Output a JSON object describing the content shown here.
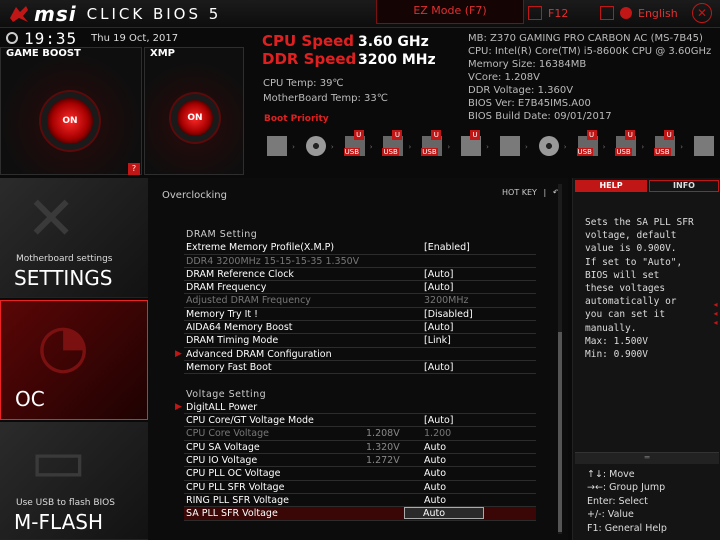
{
  "header": {
    "brand": "msi",
    "product": "CLICK BIOS 5",
    "ez_mode": "EZ Mode (F7)",
    "screenshot": "F12",
    "language": "English",
    "accent": "#c01616"
  },
  "status": {
    "time": "19:35",
    "date": "Thu  19 Oct, 2017"
  },
  "game_boost": {
    "title": "GAME BOOST",
    "state": "ON"
  },
  "xmp": {
    "title": "XMP",
    "state": "ON"
  },
  "speeds": {
    "cpu_label": "CPU Speed",
    "cpu_value": "3.60 GHz",
    "ddr_label": "DDR Speed",
    "ddr_value": "3200 MHz",
    "cpu_temp": "CPU Temp: 39℃",
    "mb_temp": "MotherBoard Temp: 33℃"
  },
  "sysinfo": {
    "mb": "MB: Z370 GAMING PRO CARBON AC (MS-7B45)",
    "cpu": "CPU: Intel(R) Core(TM) i5-8600K CPU @ 3.60GHz",
    "mem": "Memory Size: 16384MB",
    "vcore": "VCore: 1.208V",
    "ddr_voltage": "DDR Voltage: 1.360V",
    "bios_ver": "BIOS Ver: E7B45IMS.A00",
    "bios_date": "BIOS Build Date: 09/01/2017"
  },
  "boot": {
    "label": "Boot Priority",
    "devices": [
      {
        "kind": "hdd",
        "icon": "hard-drive-icon",
        "badge": ""
      },
      {
        "kind": "disc",
        "icon": "optical-disc-icon",
        "badge": ""
      },
      {
        "kind": "usb",
        "icon": "usb-drive-icon",
        "text": "USB",
        "badge": "U"
      },
      {
        "kind": "usb",
        "icon": "usb-drive-icon",
        "text": "USB",
        "badge": "U"
      },
      {
        "kind": "usb",
        "icon": "usb-key-icon",
        "text": "USB",
        "badge": "U"
      },
      {
        "kind": "hdd",
        "icon": "floppy-icon",
        "badge": "U"
      },
      {
        "kind": "hdd",
        "icon": "network-card-icon",
        "badge": ""
      },
      {
        "kind": "disc",
        "icon": "optical-disc-icon",
        "badge": ""
      },
      {
        "kind": "usb",
        "icon": "usb-drive-icon",
        "text": "USB",
        "badge": "U"
      },
      {
        "kind": "usb",
        "icon": "usb-drive-icon",
        "text": "USB",
        "badge": "U"
      },
      {
        "kind": "usb",
        "icon": "usb-key-icon",
        "text": "USB",
        "badge": "U"
      },
      {
        "kind": "hdd",
        "icon": "network-card-icon",
        "badge": ""
      }
    ]
  },
  "nav": {
    "settings_sub": "Motherboard settings",
    "settings": "SETTINGS",
    "oc": "OC",
    "mflash_sub": "Use USB to flash BIOS",
    "mflash": "M-FLASH"
  },
  "main": {
    "title": "Overclocking",
    "hotkey": "HOT KEY",
    "hotkey_sep": "|"
  },
  "rows": [
    {
      "type": "section",
      "label": "DRAM Setting"
    },
    {
      "type": "item",
      "label": "Extreme Memory Profile(X.M.P)",
      "cur": "",
      "value": "[Enabled]"
    },
    {
      "type": "dim",
      "label": "DDR4 3200MHz 15-15-15-35 1.350V",
      "cur": "",
      "value": ""
    },
    {
      "type": "item",
      "label": "DRAM Reference Clock",
      "cur": "",
      "value": "[Auto]"
    },
    {
      "type": "item",
      "label": "DRAM Frequency",
      "cur": "",
      "value": "[Auto]"
    },
    {
      "type": "dim",
      "label": "Adjusted DRAM Frequency",
      "cur": "",
      "value": "3200MHz"
    },
    {
      "type": "item",
      "label": "Memory Try It !",
      "cur": "",
      "value": "[Disabled]"
    },
    {
      "type": "item",
      "label": "AIDA64 Memory Boost",
      "cur": "",
      "value": "[Auto]"
    },
    {
      "type": "item",
      "label": "DRAM Timing Mode",
      "cur": "",
      "value": "[Link]"
    },
    {
      "type": "sub",
      "label": "Advanced DRAM Configuration",
      "cur": "",
      "value": ""
    },
    {
      "type": "item",
      "label": "Memory Fast Boot",
      "cur": "",
      "value": "[Auto]"
    },
    {
      "type": "gap",
      "label": "",
      "cur": "",
      "value": ""
    },
    {
      "type": "section",
      "label": "Voltage Setting"
    },
    {
      "type": "sub",
      "label": "DigitALL Power",
      "cur": "",
      "value": ""
    },
    {
      "type": "item",
      "label": "CPU Core/GT Voltage Mode",
      "cur": "",
      "value": "[Auto]"
    },
    {
      "type": "dim",
      "label": "CPU Core Voltage",
      "cur": "1.208V",
      "value": "1.200"
    },
    {
      "type": "item",
      "label": "CPU SA Voltage",
      "cur": "1.320V",
      "value": "Auto"
    },
    {
      "type": "item",
      "label": "CPU IO Voltage",
      "cur": "1.272V",
      "value": "Auto"
    },
    {
      "type": "item",
      "label": "CPU PLL OC Voltage",
      "cur": "",
      "value": "Auto"
    },
    {
      "type": "item",
      "label": "CPU PLL SFR Voltage",
      "cur": "",
      "value": "Auto"
    },
    {
      "type": "item",
      "label": "RING PLL SFR Voltage",
      "cur": "",
      "value": "Auto"
    },
    {
      "type": "sel",
      "label": "SA PLL SFR Voltage",
      "cur": "",
      "value": "Auto"
    }
  ],
  "help": {
    "tab_help": "HELP",
    "tab_info": "INFO",
    "lines": [
      "Sets the SA PLL SFR",
      "voltage, default",
      "value is 0.900V.",
      "If set to \"Auto\",",
      "BIOS will set",
      "these voltages",
      "automatically or",
      "you can set it",
      "manually.",
      "Max: 1.500V",
      "Min: 0.900V"
    ],
    "keys": [
      "↑↓: Move",
      "→←: Group Jump",
      "Enter: Select",
      "+/-: Value",
      "F1: General Help"
    ]
  }
}
